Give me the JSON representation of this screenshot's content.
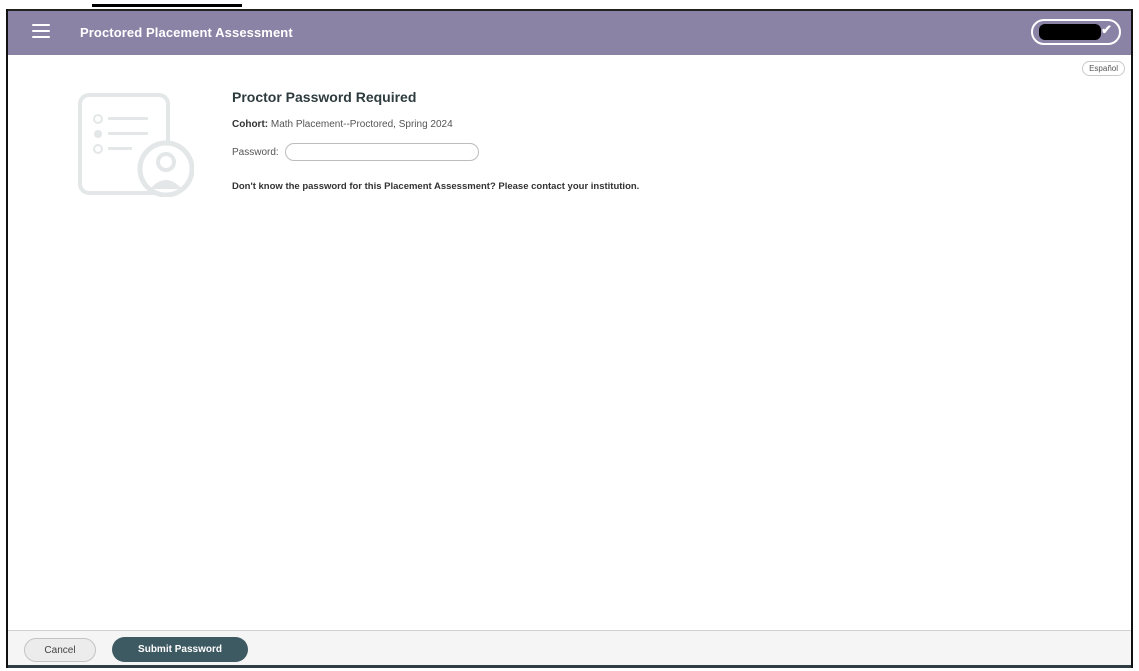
{
  "header": {
    "title": "Proctored Placement Assessment",
    "menu_icon": "hamburger-menu-icon",
    "user_menu_icon": "check-icon"
  },
  "language_button": "Español",
  "main": {
    "heading": "Proctor Password Required",
    "cohort_label": "Cohort:",
    "cohort_value": "Math Placement--Proctored, Spring 2024",
    "password_label": "Password:",
    "password_value": "",
    "help_text": "Don't know the password for this Placement Assessment? Please contact your institution.",
    "illustration_icon": "proctor-checklist-icon"
  },
  "footer": {
    "cancel_label": "Cancel",
    "submit_label": "Submit Password"
  },
  "colors": {
    "header_bg": "#8a83a6",
    "primary_button": "#3d5962",
    "illustration": "#e4e7e8"
  }
}
